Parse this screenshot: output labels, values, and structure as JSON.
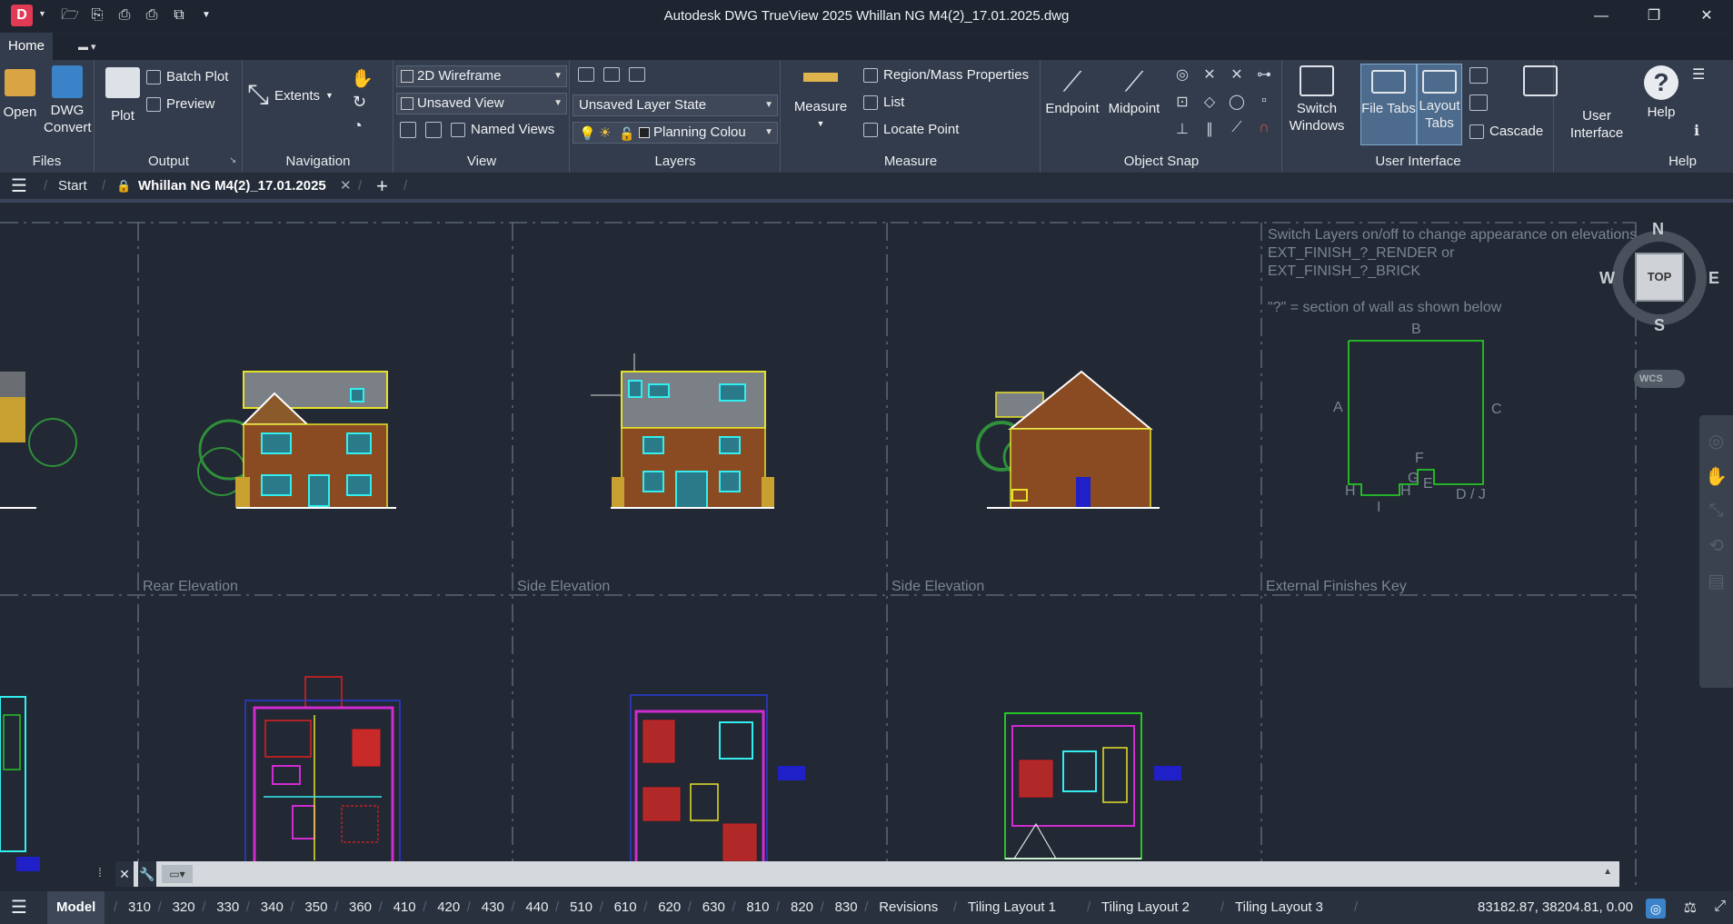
{
  "app": {
    "logo_letter": "D",
    "title": "Autodesk DWG TrueView 2025     Whillan NG M4(2)_17.01.2025.dwg"
  },
  "window_controls": {
    "minimize": "—",
    "restore": "❐",
    "close": "✕"
  },
  "ribbon_tabs": {
    "home": "Home"
  },
  "ribbon": {
    "files": {
      "title": "Files",
      "open": "Open",
      "dwg_convert_1": "DWG",
      "dwg_convert_2": "Convert"
    },
    "output": {
      "title": "Output",
      "plot": "Plot",
      "batch_plot": "Batch Plot",
      "preview": "Preview"
    },
    "navigation": {
      "title": "Navigation",
      "extents": "Extents"
    },
    "view": {
      "title": "View",
      "visual_style": "2D Wireframe",
      "named_view": "Unsaved View",
      "named_views": "Named Views"
    },
    "layers": {
      "title": "Layers",
      "layer_state": "Unsaved Layer State",
      "current_layer": "Planning Colou"
    },
    "measure": {
      "title": "Measure",
      "measure": "Measure",
      "region_mass": "Region/Mass Properties",
      "list": "List",
      "locate_point": "Locate Point"
    },
    "object_snap": {
      "title": "Object Snap",
      "endpoint": "Endpoint",
      "midpoint": "Midpoint"
    },
    "user_interface": {
      "title": "User Interface",
      "switch_windows_1": "Switch",
      "switch_windows_2": "Windows",
      "file_tabs": "File Tabs",
      "layout_tabs_1": "Layout",
      "layout_tabs_2": "Tabs",
      "cascade": "Cascade",
      "user_interface_1": "User",
      "user_interface_2": "Interface"
    },
    "help": {
      "title": "Help",
      "help": "Help"
    }
  },
  "doc_tabs": {
    "start": "Start",
    "current": "Whillan NG M4(2)_17.01.2025",
    "add": "+"
  },
  "drawing": {
    "note_line1": "Switch Layers on/off to change appearance on elevations",
    "note_line2": "EXT_FINISH_?_RENDER or",
    "note_line3": "EXT_FINISH_?_BRICK",
    "note_line4": "\"?\" = section of wall as shown below",
    "key_labels": {
      "a": "A",
      "b": "B",
      "c": "C",
      "f": "F",
      "g": "G",
      "e": "E",
      "h1": "H",
      "h2": "H",
      "i": "I",
      "dj": "D / J"
    },
    "captions": {
      "rear": "Rear Elevation",
      "side1": "Side Elevation",
      "side2": "Side Elevation",
      "key": "External Finishes Key"
    }
  },
  "viewcube": {
    "n": "N",
    "s": "S",
    "e": "E",
    "w": "W",
    "face": "TOP",
    "wcs": "WCS"
  },
  "layout_tabs": [
    "Model",
    "310",
    "320",
    "330",
    "340",
    "350",
    "360",
    "410",
    "420",
    "430",
    "440",
    "510",
    "610",
    "620",
    "630",
    "810",
    "820",
    "830",
    "Revisions",
    "Tiling Layout 1",
    "Tiling Layout 2",
    "Tiling Layout 3"
  ],
  "status": {
    "coordinates": "83182.87, 38204.81, 0.00"
  },
  "colors": {
    "accent": "#e03a55",
    "background": "#222834",
    "ribbon": "#333c4c",
    "selected": "#4d6b8c"
  }
}
